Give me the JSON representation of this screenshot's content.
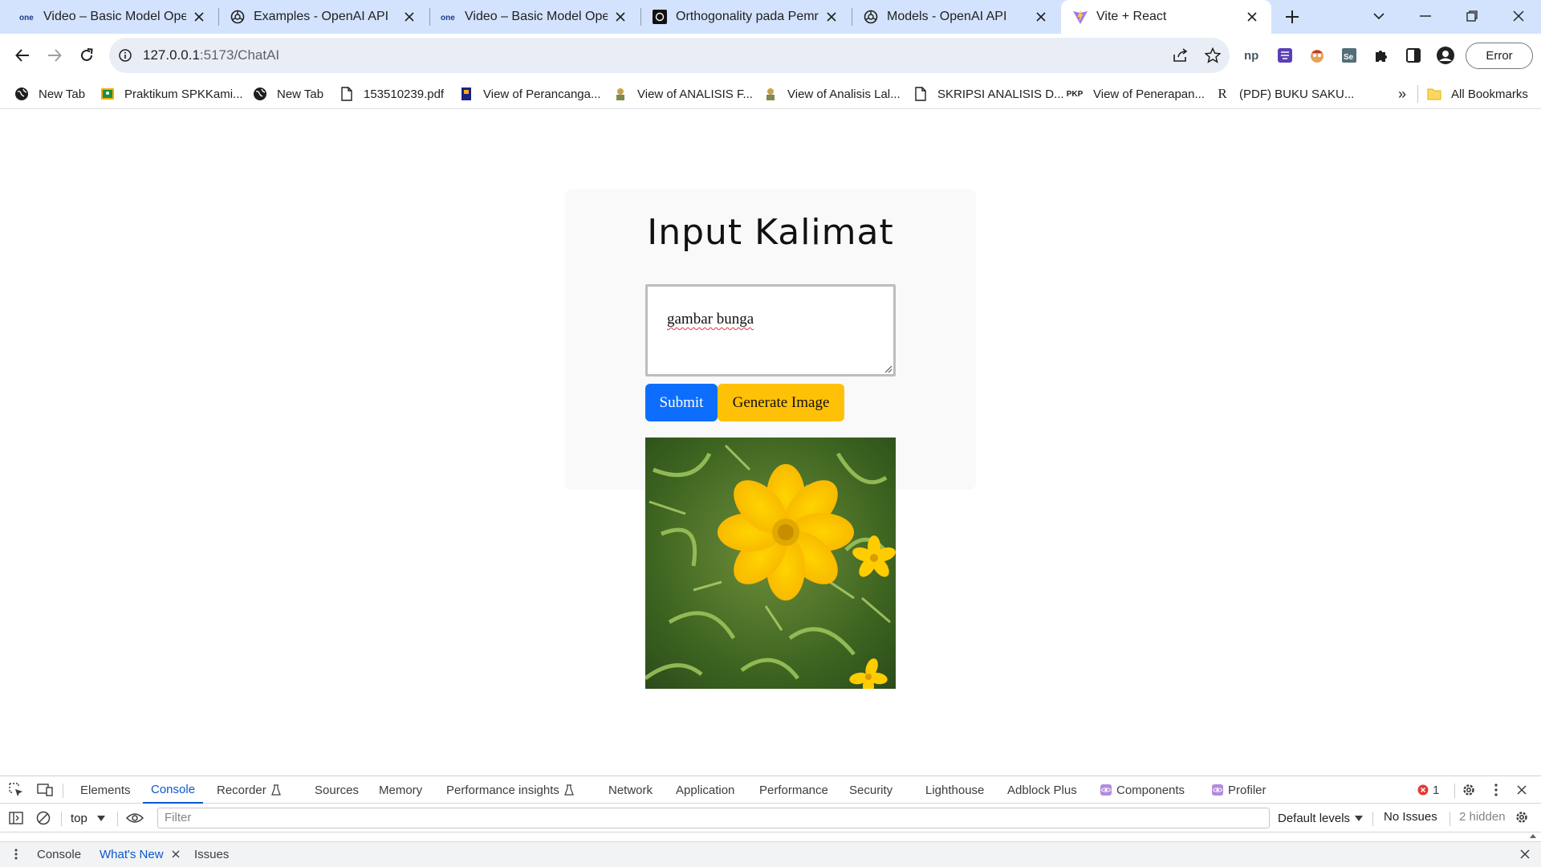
{
  "browser": {
    "tabs": [
      {
        "title": "Video – Basic Model OpenAI",
        "icon": "onelearn-icon"
      },
      {
        "title": "Examples - OpenAI API",
        "icon": "openai-icon"
      },
      {
        "title": "Video – Basic Model OpenAI",
        "icon": "onelearn-icon"
      },
      {
        "title": "Orthogonality pada Pemrograman",
        "icon": "openai-dark-icon"
      },
      {
        "title": "Models - OpenAI API",
        "icon": "openai-icon"
      },
      {
        "title": "Vite + React",
        "icon": "vite-icon",
        "active": true
      }
    ],
    "url_host": "127.0.0.1",
    "url_path": ":5173/ChatAI",
    "profile_status": "Error",
    "bookmarks": [
      {
        "label": "New Tab"
      },
      {
        "label": "Praktikum SPKKami..."
      },
      {
        "label": "New Tab"
      },
      {
        "label": "153510239.pdf"
      },
      {
        "label": "View of Perancanga..."
      },
      {
        "label": "View of ANALISIS F..."
      },
      {
        "label": "View of Analisis Lal..."
      },
      {
        "label": "SKRIPSI ANALISIS D..."
      },
      {
        "label": "View of Penerapan..."
      },
      {
        "label": "(PDF) BUKU SAKU..."
      }
    ],
    "bookmark_badge_pkp": "PKP",
    "bookmark_badge_r": "R",
    "more_bookmarks": "»",
    "all_bookmarks": "All Bookmarks"
  },
  "page": {
    "heading": "Input Kalimat",
    "prompt_value": "gambar bunga",
    "submit_label": "Submit",
    "generate_label": "Generate Image",
    "result_image": "yellow-cosmos-flower"
  },
  "devtools": {
    "tabs": [
      "Elements",
      "Console",
      "Recorder",
      "Sources",
      "Memory",
      "Performance insights",
      "Network",
      "Application",
      "Performance",
      "Security",
      "Lighthouse",
      "Adblock Plus",
      "Components",
      "Profiler"
    ],
    "active_tab": "Console",
    "error_count": "1",
    "context": "top",
    "filter_placeholder": "Filter",
    "levels": "Default levels",
    "issues": "No Issues",
    "hidden": "2 hidden",
    "drawer_tabs": [
      "Console",
      "What's New",
      "Issues"
    ]
  },
  "colors": {
    "tabstrip": "#d3e3fd",
    "submit": "#0d6efd",
    "generate": "#ffc107",
    "devtools_active": "#0b57d0"
  }
}
